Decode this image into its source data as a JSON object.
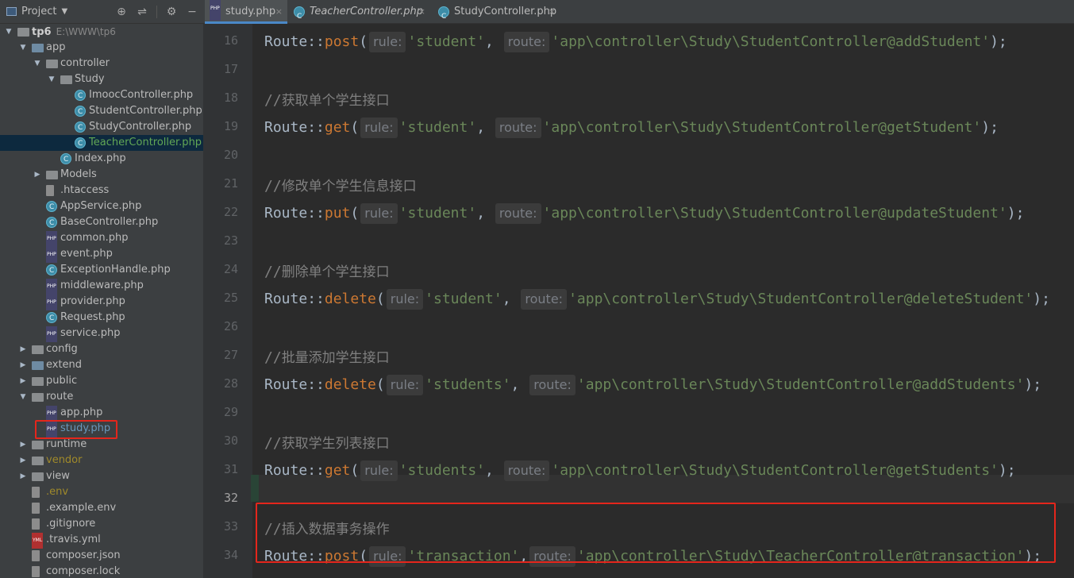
{
  "project_panel": {
    "title": "Project",
    "tools": [
      "⊕",
      "⇌",
      "⚙",
      "−"
    ],
    "tree": [
      {
        "label": "tp6",
        "path": "E:\\WWW\\tp6",
        "depth": 0,
        "type": "folder",
        "expanded": true
      },
      {
        "label": "app",
        "depth": 1,
        "type": "folder-src",
        "expanded": true
      },
      {
        "label": "controller",
        "depth": 2,
        "type": "folder",
        "expanded": true
      },
      {
        "label": "Study",
        "depth": 3,
        "type": "folder",
        "expanded": true
      },
      {
        "label": "ImoocController.php",
        "depth": 4,
        "type": "class"
      },
      {
        "label": "StudentController.php",
        "depth": 4,
        "type": "class"
      },
      {
        "label": "StudyController.php",
        "depth": 4,
        "type": "class"
      },
      {
        "label": "TeacherController.php",
        "depth": 4,
        "type": "class",
        "selected": true,
        "color": "green"
      },
      {
        "label": "Index.php",
        "depth": 3,
        "type": "class"
      },
      {
        "label": "Models",
        "depth": 2,
        "type": "folder",
        "expanded": false
      },
      {
        "label": ".htaccess",
        "depth": 2,
        "type": "file"
      },
      {
        "label": "AppService.php",
        "depth": 2,
        "type": "class"
      },
      {
        "label": "BaseController.php",
        "depth": 2,
        "type": "class"
      },
      {
        "label": "common.php",
        "depth": 2,
        "type": "php"
      },
      {
        "label": "event.php",
        "depth": 2,
        "type": "php"
      },
      {
        "label": "ExceptionHandle.php",
        "depth": 2,
        "type": "class"
      },
      {
        "label": "middleware.php",
        "depth": 2,
        "type": "php"
      },
      {
        "label": "provider.php",
        "depth": 2,
        "type": "php"
      },
      {
        "label": "Request.php",
        "depth": 2,
        "type": "class"
      },
      {
        "label": "service.php",
        "depth": 2,
        "type": "php"
      },
      {
        "label": "config",
        "depth": 1,
        "type": "folder",
        "expanded": false
      },
      {
        "label": "extend",
        "depth": 1,
        "type": "folder-src",
        "expanded": false
      },
      {
        "label": "public",
        "depth": 1,
        "type": "folder",
        "expanded": false
      },
      {
        "label": "route",
        "depth": 1,
        "type": "folder",
        "expanded": true
      },
      {
        "label": "app.php",
        "depth": 2,
        "type": "php"
      },
      {
        "label": "study.php",
        "depth": 2,
        "type": "php",
        "color": "blue"
      },
      {
        "label": "runtime",
        "depth": 1,
        "type": "folder",
        "expanded": false
      },
      {
        "label": "vendor",
        "depth": 1,
        "type": "folder",
        "expanded": false,
        "color": "yellow"
      },
      {
        "label": "view",
        "depth": 1,
        "type": "folder",
        "expanded": false
      },
      {
        "label": ".env",
        "depth": 1,
        "type": "file",
        "color": "yellow"
      },
      {
        "label": ".example.env",
        "depth": 1,
        "type": "file"
      },
      {
        "label": ".gitignore",
        "depth": 1,
        "type": "gear"
      },
      {
        "label": ".travis.yml",
        "depth": 1,
        "type": "yml"
      },
      {
        "label": "composer.json",
        "depth": 1,
        "type": "file"
      },
      {
        "label": "composer.lock",
        "depth": 1,
        "type": "file"
      }
    ]
  },
  "tabs": [
    {
      "label": "study.php",
      "icon": "php",
      "active": true
    },
    {
      "label": "TeacherController.php",
      "icon": "class",
      "italic": true
    },
    {
      "label": "StudyController.php",
      "icon": "class"
    }
  ],
  "tab_close_glyph": "×",
  "editor": {
    "current_line": 32,
    "lines": [
      {
        "num": 16,
        "kind": "code",
        "method": "post",
        "rule": "'student'",
        "route": "'app\\controller\\Study\\StudentController@addStudent'"
      },
      {
        "num": 17,
        "kind": "blank"
      },
      {
        "num": 18,
        "kind": "comment",
        "text": "获取单个学生接口"
      },
      {
        "num": 19,
        "kind": "code",
        "method": "get",
        "rule": "'student'",
        "route": "'app\\controller\\Study\\StudentController@getStudent'"
      },
      {
        "num": 20,
        "kind": "blank"
      },
      {
        "num": 21,
        "kind": "comment",
        "text": "修改单个学生信息接口"
      },
      {
        "num": 22,
        "kind": "code",
        "method": "put",
        "rule": "'student'",
        "route": "'app\\controller\\Study\\StudentController@updateStudent'"
      },
      {
        "num": 23,
        "kind": "blank"
      },
      {
        "num": 24,
        "kind": "comment",
        "text": "删除单个学生接口"
      },
      {
        "num": 25,
        "kind": "code",
        "method": "delete",
        "rule": "'student'",
        "route": "'app\\controller\\Study\\StudentController@deleteStudent'"
      },
      {
        "num": 26,
        "kind": "blank"
      },
      {
        "num": 27,
        "kind": "comment",
        "text": "批量添加学生接口"
      },
      {
        "num": 28,
        "kind": "code",
        "method": "delete",
        "rule": "'students'",
        "route": "'app\\controller\\Study\\StudentController@addStudents'"
      },
      {
        "num": 29,
        "kind": "blank"
      },
      {
        "num": 30,
        "kind": "comment",
        "text": "获取学生列表接口"
      },
      {
        "num": 31,
        "kind": "code",
        "method": "get",
        "rule": "'students'",
        "route": "'app\\controller\\Study\\StudentController@getStudents'"
      },
      {
        "num": 32,
        "kind": "blank"
      },
      {
        "num": 33,
        "kind": "comment",
        "text": "插入数据事务操作"
      },
      {
        "num": 34,
        "kind": "code",
        "method": "post",
        "rule": "'transaction'",
        "route": "'app\\controller\\Study\\TeacherController@transaction'",
        "tight": true
      }
    ],
    "tokens": {
      "class": "Route",
      "sep": "::",
      "open": "(",
      "close": ");",
      "comma": ",",
      "comment_prefix": "//",
      "rule_hint": "rule:",
      "route_hint": "route:"
    }
  },
  "colors": {
    "highlight_box": "#e4261c",
    "selection_bg": "#0d293e",
    "string": "#6a8759",
    "method": "#ffc66d",
    "comment": "#808080"
  }
}
